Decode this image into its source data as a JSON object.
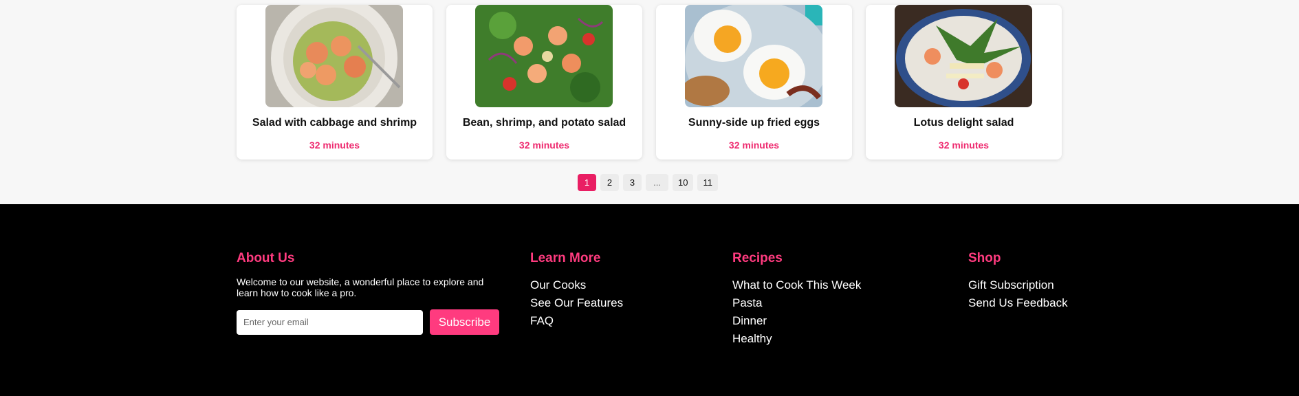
{
  "recipes": [
    {
      "title": "Salad with cabbage and shrimp",
      "time": "32 minutes"
    },
    {
      "title": "Bean, shrimp, and potato salad",
      "time": "32 minutes"
    },
    {
      "title": "Sunny-side up fried eggs",
      "time": "32 minutes"
    },
    {
      "title": "Lotus delight salad",
      "time": "32 minutes"
    }
  ],
  "pagination": {
    "pages": [
      "1",
      "2",
      "3",
      "...",
      "10",
      "11"
    ],
    "current": "1"
  },
  "footer": {
    "about": {
      "heading": "About Us",
      "text": "Welcome to our website, a wonderful place to explore and learn how to cook like a pro.",
      "email_placeholder": "Enter your email",
      "subscribe_label": "Subscribe"
    },
    "learn_more": {
      "heading": "Learn More",
      "links": [
        "Our Cooks",
        "See Our Features",
        "FAQ"
      ]
    },
    "recipes": {
      "heading": "Recipes",
      "links": [
        "What to Cook This Week",
        "Pasta",
        "Dinner",
        "Healthy"
      ]
    },
    "shop": {
      "heading": "Shop",
      "links": [
        "Gift Subscription",
        "Send Us Feedback"
      ]
    }
  },
  "colors": {
    "accent": "#ff3b7f",
    "active_page": "#e91e63",
    "time_text": "#ee2a6f",
    "footer_bg": "#000000"
  }
}
